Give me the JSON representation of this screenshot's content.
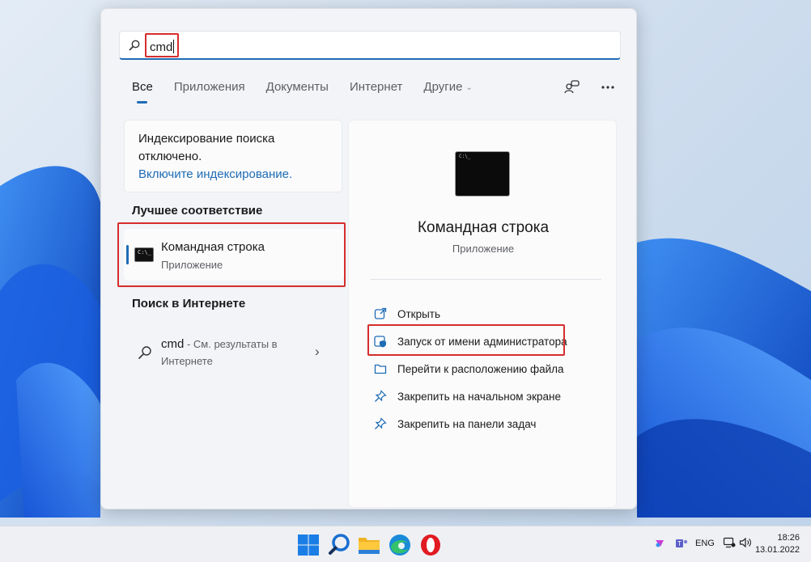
{
  "search": {
    "query": "cmd",
    "icon": "search-icon"
  },
  "tabs": [
    {
      "label": "Все",
      "active": true
    },
    {
      "label": "Приложения"
    },
    {
      "label": "Документы"
    },
    {
      "label": "Интернет"
    },
    {
      "label": "Другие"
    }
  ],
  "top_icons": [
    "account-switch-icon",
    "more-options-icon"
  ],
  "indexing": {
    "line1": "Индексирование поиска",
    "line2": "отключено.",
    "link": "Включите индексирование."
  },
  "best_match": {
    "heading": "Лучшее соответствие",
    "name": "Командная строка",
    "type": "Приложение"
  },
  "web_search": {
    "heading": "Поиск в Интернете",
    "query": "cmd",
    "suffix_line1": " - См. результаты в",
    "suffix_line2": "Интернете"
  },
  "detail": {
    "title": "Командная строка",
    "subtitle": "Приложение",
    "actions": [
      {
        "label": "Открыть",
        "icon": "open-icon"
      },
      {
        "label": "Запуск от имени администратора",
        "icon": "shield-icon"
      },
      {
        "label": "Перейти к расположению файла",
        "icon": "folder-icon"
      },
      {
        "label": "Закрепить на начальном экране",
        "icon": "pin-icon"
      },
      {
        "label": "Закрепить на панели задач",
        "icon": "pin-icon"
      }
    ]
  },
  "taskbar": {
    "apps": [
      "windows-start-icon",
      "search-icon",
      "file-explorer-icon",
      "edge-icon",
      "opera-icon"
    ],
    "language": "ENG",
    "time": "18:26",
    "date": "13.01.2022"
  },
  "colors": {
    "accent": "#1f6cb4",
    "highlight": "#d62d2d"
  }
}
